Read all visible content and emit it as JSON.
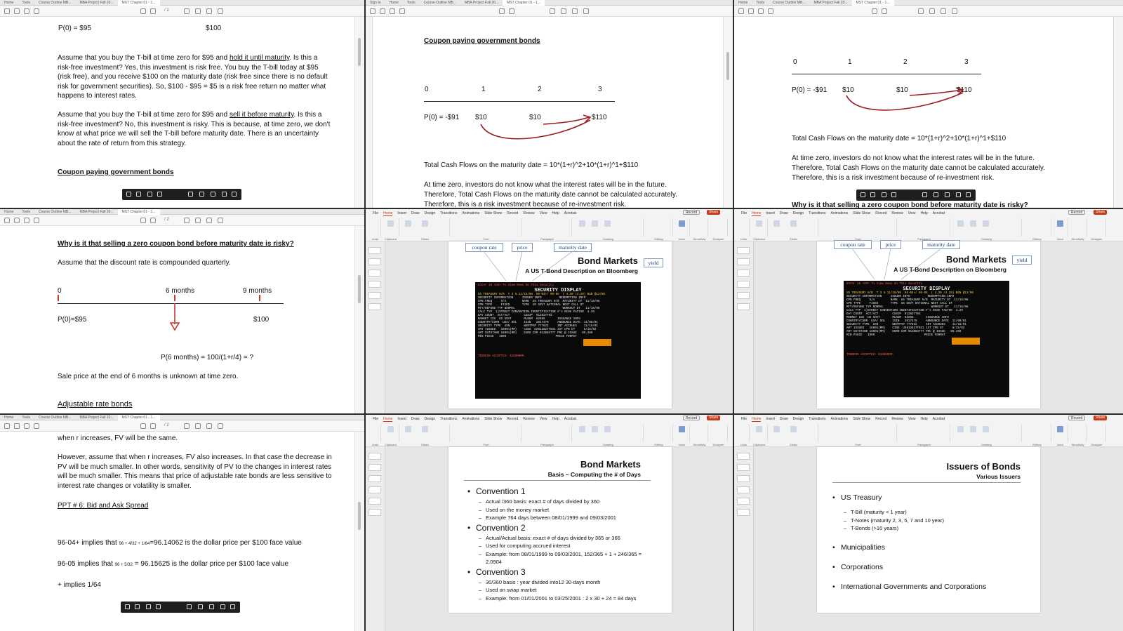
{
  "pdf_tabs": {
    "home": "Home",
    "tools": "Tools",
    "course": "Course Outline MB...",
    "mba": "MBA Project Fall 20...",
    "chapter": "MST Chapter 01 - 1...",
    "signin": "Sign In"
  },
  "pdf_toolbar": {
    "page": "/ 2"
  },
  "pane1": {
    "line1_p0": "P(0) = $95",
    "line1_fv": "$100",
    "para1_a": "Assume that you buy the T-bill at time zero for $95 and ",
    "para1_u": "hold it until maturity",
    "para1_b": ". Is this a risk-free investment?  Yes, this investment is risk free. You buy the T-bill today at $95 (risk free), and you receive $100 on the maturity date (risk free since there is no default risk for government securities). So, $100 - $95 = $5 is a risk free return no matter what happens to interest rates.",
    "para2_a": "Assume that you buy the T-bill at time zero for $95 and ",
    "para2_u": "sell it before maturity",
    "para2_b": ". Is this a risk-free investment? No, this investment is risky. This is because, at time zero, we don't know at what price we will sell the T-bill before maturity date. There is an uncertainty about the rate of return from this strategy.",
    "heading": "Coupon paying government bonds"
  },
  "pane2": {
    "heading": "Coupon paying government bonds",
    "t0": "0",
    "t1": "1",
    "t2": "2",
    "t3": "3",
    "p0": "P(0) = -$91",
    "c1": "$10",
    "c2": "$10",
    "c3": "$110",
    "total": "Total Cash Flows on the maturity date = 10*(1+r)^2+10*(1+r)^1+$110",
    "para_a": "At time zero, investors do not know what the interest rates will be in the future.",
    "para_b": "Therefore, Total Cash Flows on the maturity date cannot be calculated accurately.",
    "para_c": "Therefore, this is a risk investment because of re-investment risk."
  },
  "pane3": {
    "t0": "0",
    "t1": "1",
    "t2": "2",
    "t3": "3",
    "p0": "P(0) = -$91",
    "c1": "$10",
    "c2": "$10",
    "c3": "$110",
    "total": "Total Cash Flows on the maturity date = 10*(1+r)^2+10*(1+r)^1+$110",
    "para_a": "At time zero, investors do not know what the interest rates will be in the future.",
    "para_b": "Therefore, Total Cash Flows on the maturity date cannot be calculated accurately.",
    "para_c": "Therefore, this is a risk investment because of re-investment risk.",
    "cut_heading": "Why is it that selling a zero coupon bond before maturity date is risky?"
  },
  "pane4": {
    "heading": "Why is it that selling a zero coupon bond before maturity date is risky?",
    "assume": "Assume that the discount rate is compounded quarterly.",
    "t0": "0",
    "t6": "6 months",
    "t9": "9 months",
    "p0": "P(0)=$95",
    "fv": "$100",
    "formula": "P(6 months) = 100/(1+r/4) = ?",
    "sale": "Sale price at the end of 6 months is unknown at time zero.",
    "adj": "Adjustable rate bonds"
  },
  "pane7": {
    "line0": "when r increases, FV will be the same.",
    "para": "However, assume that when r increases, FV also increases. In that case the decrease in PV will be much smaller. In other words, sensitivity of PV to the changes in interest rates will be much smaller. This means that price of adjustable rate bonds are less sensitive to interest rate changes or volatility is smaller.",
    "ppt": "PPT # 6:   Bid and Ask Spread",
    "q1_pre": "96-04+ implies that ",
    "q1_math": "96 + 4/32 + 1/64",
    "q1_post": "=96.14062 is the dollar price per $100 face value",
    "q2_pre": "96-05 implies that ",
    "q2_math": "96 + 5/32",
    "q2_post": " = 96.15625 is the dollar price per $100 face value",
    "plus": "+ implies 1/64"
  },
  "ppt_ribbon": {
    "tabs": [
      "File",
      "Home",
      "Insert",
      "Draw",
      "Design",
      "Transitions",
      "Animations",
      "Slide Show",
      "Record",
      "Review",
      "View",
      "Help",
      "Acrobat"
    ],
    "groups": [
      "Undo",
      "Clipboard",
      "Slides",
      "Font",
      "Paragraph",
      "Drawing",
      "Editing",
      "Voice",
      "Sensitivity",
      "Designer"
    ],
    "record": "Record",
    "share": "Share"
  },
  "slide_bloomberg": {
    "title": "Bond Markets",
    "subtitle": "A US T-Bond Description on Bloomberg",
    "callouts": [
      "coupon rate",
      "price",
      "maturity date",
      "yield"
    ],
    "terminal_header": "Enter 10 <GO> To View News On This Security",
    "terminal_title": "SECURITY DISPLAY",
    "terminal_lines": [
      "US TREASURY N/B  T 3 ⅞ 11/15/06  96-04+/ 96-05  ( 4.30 /4.29) BGN @12/00",
      "SECURITY INFORMATION     ISSUER INFO          REDEMPTION INFO",
      "CPN FREQ     S/A         NAME  US TREASURY N/B  MATURITY DT  11/15/06",
      "CPN TYPE     FIXED       TYPE  US GOVT NATIONAL NEXT CALL DT",
      "MTY/REFUND TYP NORMAL                           WORKOUT DT   11/15/06",
      "CALC TYP  1)STREET CONVENTION IDENTIFICATION #'s RISK FACTOR  4.29",
      "DAY COUNT  ACT/ACT        CUSIP  912827T93",
      "MARKET ISS  US GOVT       MLNUM  H2665       ISSUANCE INFO",
      "COUNTRY/CURR  USA/ DOL    ISIN   2017479     ANNOUNCE DATE  11/08/01",
      "SECURITY TYPE  USN        WERTPAP 777622     INT ACCRUES    11/15/01",
      "AMT ISSUED   18001(MM)    CINS  US912827T931 1ST CPN DT     5/15/02",
      "AMT OUTSTAND 18001(MM)    EURO COM 013883777 PRC @ ISSUE   99.469",
      "MIN PIECE   1000                            PRICE FORMAT",
      "TENDERS ACCEPTED: $16000MM."
    ]
  },
  "slide_days": {
    "title": "Bond Markets",
    "subtitle": "Basis – Computing the # of Days",
    "conventions": [
      {
        "name": "Convention 1",
        "items": [
          "Actual /360 basis: exact # of days divided by 360",
          "Used on the money market",
          "Example 764 days between 08/01/1999 and 09/03/2001"
        ]
      },
      {
        "name": "Convention 2",
        "items": [
          "Actual/Actual basis: exact # of days divided by 365 or 366",
          "Used for computing accrued interest",
          "Example: from 08/01/1999 to 09/03/2001, 152/365 + 1 + 246/365 = 2.0904"
        ]
      },
      {
        "name": "Convention 3",
        "items": [
          "30/360 basis : year divided into12 30-days month",
          "Used on swap market",
          "Example: from 01/01/2001 to 03/25/2001 : 2 x 30 + 24 = 84 days"
        ]
      }
    ]
  },
  "slide_issuers": {
    "title": "Issuers of Bonds",
    "subtitle": "Various Issuers",
    "treasury": "US Treasury",
    "treasury_items": [
      "T-Bill (maturity < 1 year)",
      "T-Notes (maturity 2, 3, 5, 7 and 10 year)",
      "T-Bonds (>10 years)"
    ],
    "others": [
      "Municipalities",
      "Corporations",
      "International Governments and Corporations"
    ]
  },
  "colors": {
    "accent_arrow": "#9b1c22",
    "ppt_accent": "#c43e1c",
    "terminal_bg": "#0a0a0a",
    "terminal_highlight": "#e68a00"
  }
}
